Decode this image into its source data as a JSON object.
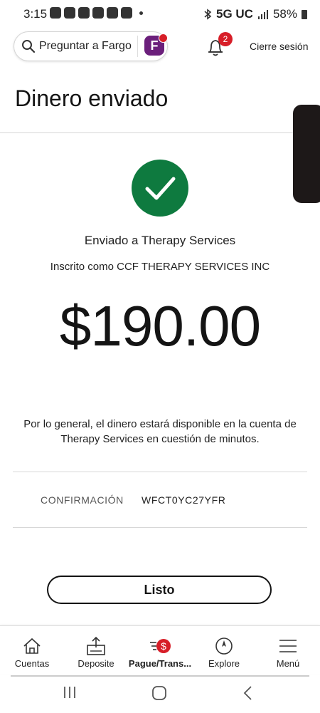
{
  "status_bar": {
    "time": "3:15",
    "network": "5G UC",
    "battery": "58%"
  },
  "header": {
    "search_placeholder": "Preguntar a Fargo",
    "notification_count": "2",
    "sign_out": "Cierre sesión"
  },
  "page": {
    "title": "Dinero enviado"
  },
  "confirmation": {
    "sent_to": "Enviado a Therapy Services",
    "enrolled_as": "Inscrito como CCF THERAPY SERVICES INC",
    "amount": "$190.00",
    "notice": "Por lo general, el dinero estará disponible en la cuenta de Therapy Services en cuestión de minutos.",
    "confirmation_label": "CONFIRMACIÓN",
    "confirmation_number": "WFCT0YC27YFR",
    "done_label": "Listo"
  },
  "tabs": [
    {
      "label": "Cuentas",
      "icon": "home-icon"
    },
    {
      "label": "Deposite",
      "icon": "deposit-icon"
    },
    {
      "label": "Pague/Trans...",
      "icon": "pay-transfer-icon"
    },
    {
      "label": "Explore",
      "icon": "compass-icon"
    },
    {
      "label": "Menú",
      "icon": "menu-icon"
    }
  ],
  "colors": {
    "success_green": "#0e7a3f",
    "brand_red": "#d71e28",
    "fargo_purple": "#6b1f7b"
  }
}
